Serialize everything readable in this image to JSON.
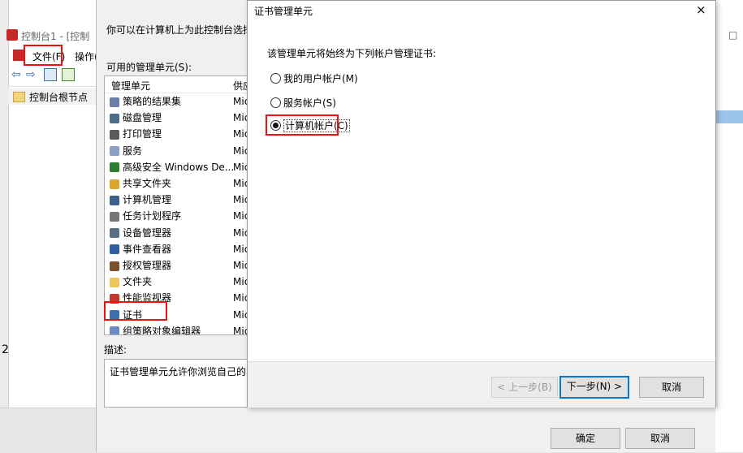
{
  "mmc": {
    "title": "控制台1 - [控制",
    "menu": {
      "file": "文件(F)",
      "action": "操作(A"
    },
    "tree_root": "控制台根节点",
    "bottom_number": "2",
    "right_pane_close": "□"
  },
  "addremove": {
    "intro": "你可以在计算机上为此控制台选择",
    "available_label": "可用的管理单元(S):",
    "columns": {
      "snapin": "管理单元",
      "vendor": "供应"
    },
    "items": [
      {
        "name": "策略的结果集",
        "vendor": "Mic",
        "icon": "policy-icon"
      },
      {
        "name": "磁盘管理",
        "vendor": "Mic",
        "icon": "disk-icon"
      },
      {
        "name": "打印管理",
        "vendor": "Mic",
        "icon": "printer-icon"
      },
      {
        "name": "服务",
        "vendor": "Mic",
        "icon": "services-icon"
      },
      {
        "name": "高级安全 Windows De...",
        "vendor": "Mic",
        "icon": "firewall-icon"
      },
      {
        "name": "共享文件夹",
        "vendor": "Mic",
        "icon": "shared-folder-icon"
      },
      {
        "name": "计算机管理",
        "vendor": "Mic",
        "icon": "computer-management-icon"
      },
      {
        "name": "任务计划程序",
        "vendor": "Mic",
        "icon": "clock-icon"
      },
      {
        "name": "设备管理器",
        "vendor": "Mic",
        "icon": "device-icon"
      },
      {
        "name": "事件查看器",
        "vendor": "Mic",
        "icon": "event-viewer-icon"
      },
      {
        "name": "授权管理器",
        "vendor": "Mic",
        "icon": "authorization-icon"
      },
      {
        "name": "文件夹",
        "vendor": "Mic",
        "icon": "folder-icon"
      },
      {
        "name": "性能监视器",
        "vendor": "Mic",
        "icon": "performance-icon"
      },
      {
        "name": "证书",
        "vendor": "Mic",
        "icon": "certificate-icon"
      },
      {
        "name": "组策略对象编辑器",
        "vendor": "Mic",
        "icon": "group-policy-icon"
      }
    ],
    "description_label": "描述:",
    "description": "证书管理单元允许你浏览自己的、",
    "ok": "确定",
    "cancel": "取消"
  },
  "wizard": {
    "title": "证书管理单元",
    "close": "×",
    "prompt": "该管理单元将始终为下列帐户管理证书:",
    "options": [
      {
        "label": "我的用户帐户(M)",
        "checked": false
      },
      {
        "label": "服务帐户(S)",
        "checked": false
      },
      {
        "label": "计算机帐户(C)",
        "checked": true
      }
    ],
    "back": "< 上一步(B)",
    "next": "下一步(N) >",
    "cancel": "取消"
  },
  "colors": {
    "highlight": "#e11111",
    "focus": "#0078d7"
  }
}
